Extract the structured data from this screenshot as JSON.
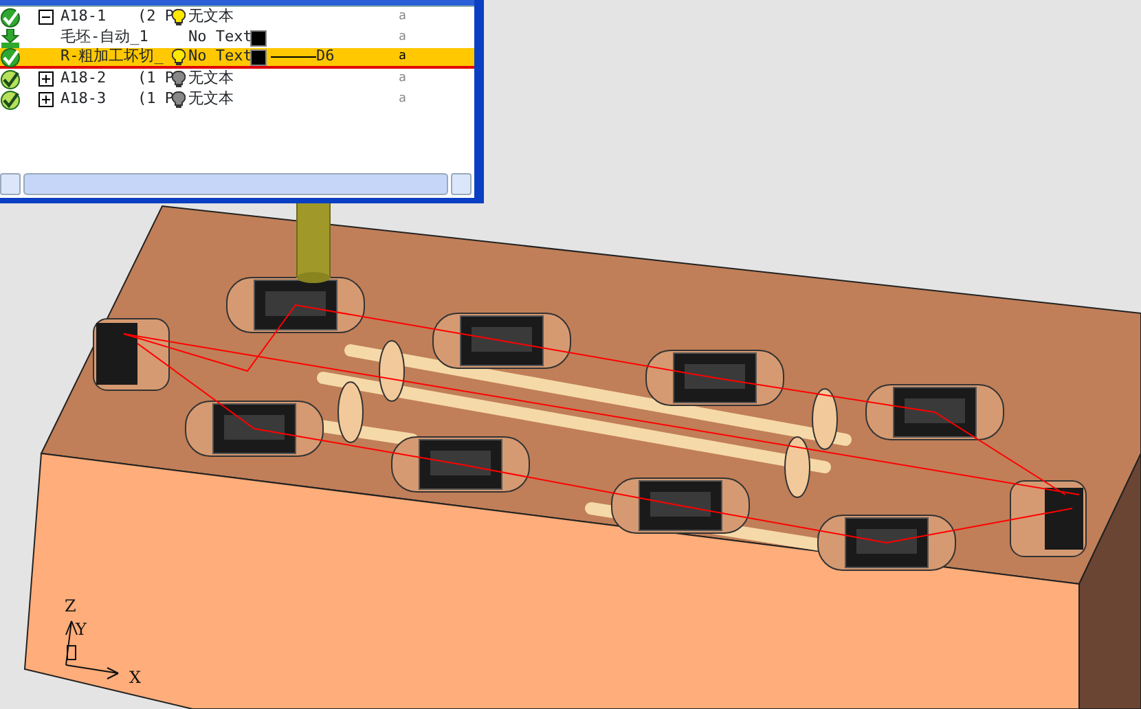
{
  "tree": {
    "rows": [
      {
        "kind": "done",
        "expanded": true,
        "name": "A18-1",
        "count": "(2 P",
        "lit": true,
        "tool": "无文本",
        "column_6": "a",
        "selected": false,
        "children": [
          {
            "kind": "stock",
            "name": "毛坯-自动_1",
            "tool": "No Text",
            "color": "#000000",
            "column_6": "a",
            "selected": false
          },
          {
            "kind": "done",
            "name": "R-粗加工坏切_",
            "lit": true,
            "tool": "No Text",
            "color": "#000000",
            "column_5": "D6",
            "column_6": "a",
            "selected": true
          }
        ]
      },
      {
        "kind": "stale",
        "expanded": false,
        "name": "A18-2",
        "count": "(1 P",
        "lit": false,
        "tool": "无文本",
        "column_6": "a",
        "selected": false
      },
      {
        "kind": "stale",
        "expanded": false,
        "name": "A18-3",
        "count": "(1 P",
        "lit": false,
        "tool": "无文本",
        "column_6": "a",
        "selected": false
      }
    ]
  },
  "viewport": {
    "axes": {
      "z": "Z",
      "y": "Y",
      "x": "X"
    }
  }
}
